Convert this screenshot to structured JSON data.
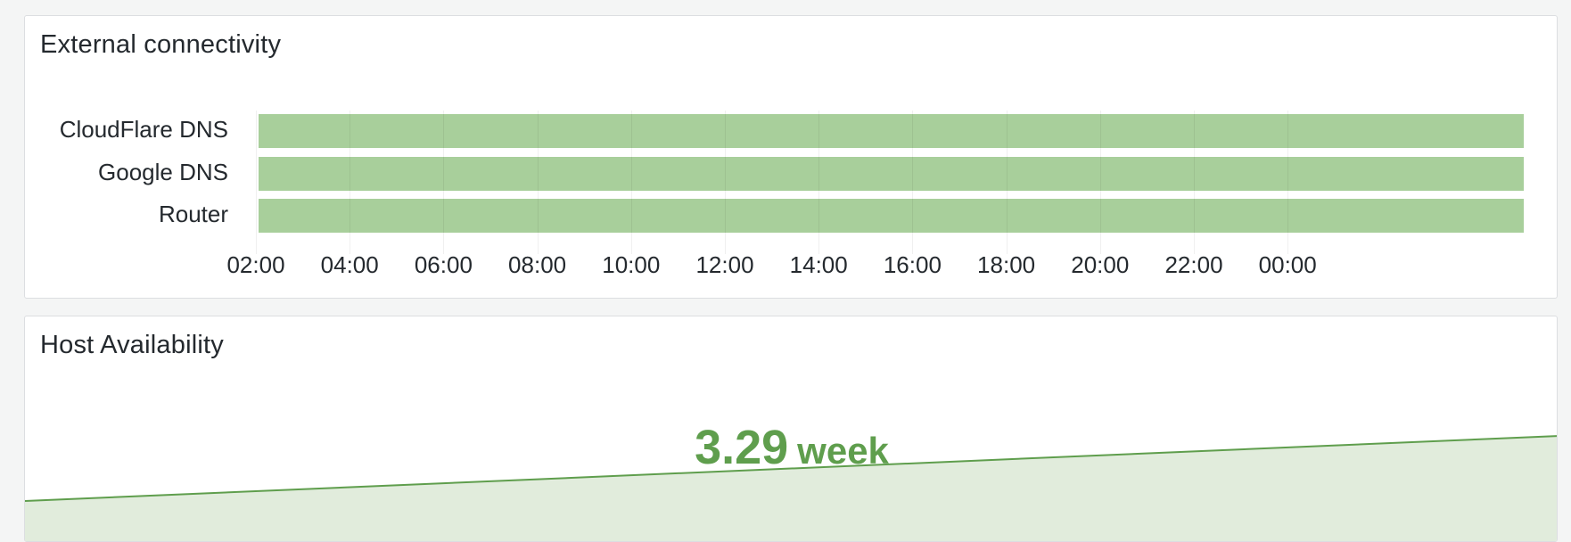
{
  "panels": {
    "external": {
      "title": "External connectivity",
      "rows": [
        {
          "label": "CloudFlare DNS",
          "state": "up"
        },
        {
          "label": "Google DNS",
          "state": "up"
        },
        {
          "label": "Router",
          "state": "up"
        }
      ],
      "state_color": "#a8cf9b",
      "ticks": [
        "02:00",
        "04:00",
        "06:00",
        "08:00",
        "10:00",
        "12:00",
        "14:00",
        "16:00",
        "18:00",
        "20:00",
        "22:00",
        "00:00"
      ]
    },
    "host": {
      "title": "Host Availability",
      "value": "3.29",
      "unit": "week",
      "color": "#5f9e4d",
      "fill_color": "#e1ecdc"
    }
  }
}
